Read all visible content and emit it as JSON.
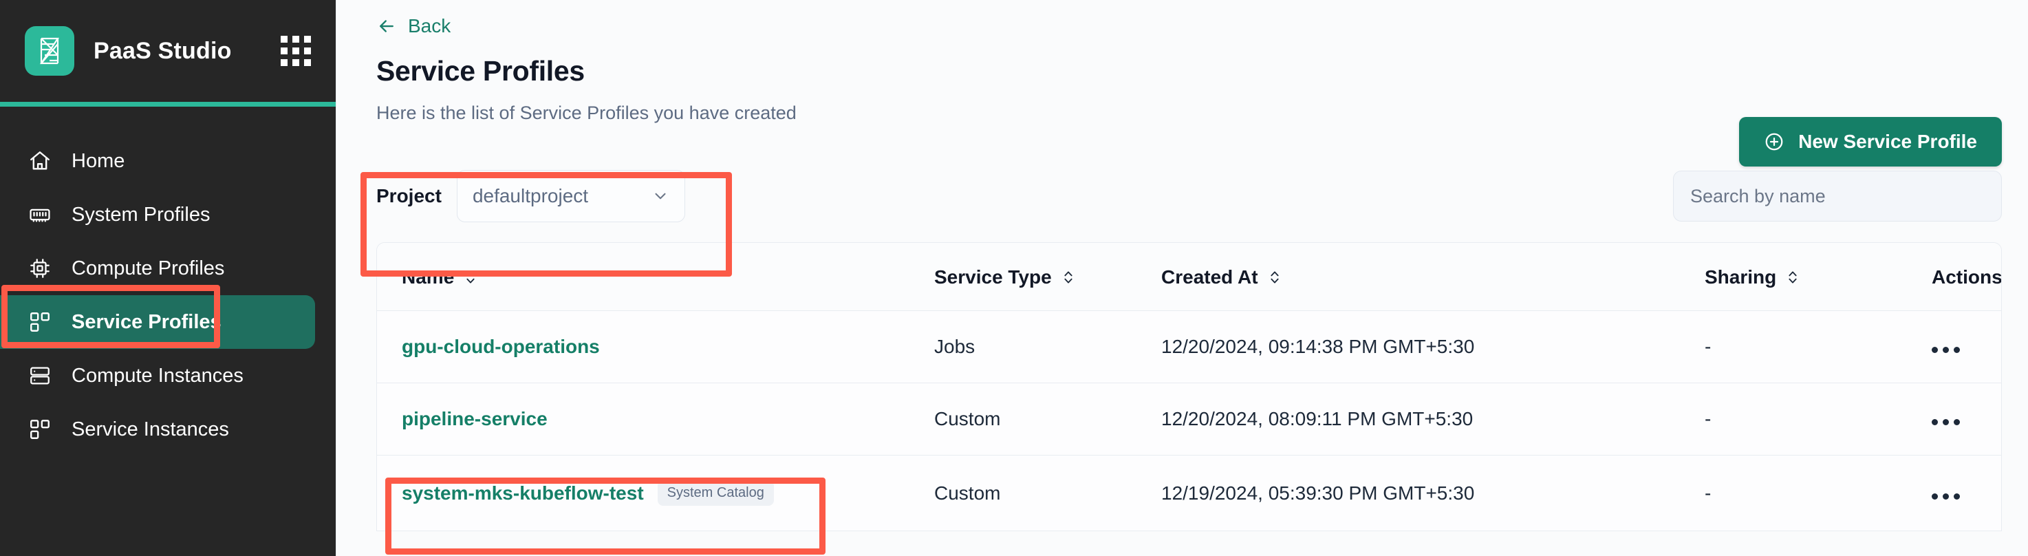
{
  "sidebar": {
    "brand": "PaaS Studio",
    "logo_icon": "paas-logo-icon",
    "apps_grid_icon": "apps-grid-icon",
    "accent_color": "#2cb99a",
    "background_color": "#262626",
    "active_item_color": "#1f6f5f",
    "items": [
      {
        "label": "Home",
        "icon": "home-icon",
        "active": false
      },
      {
        "label": "System Profiles",
        "icon": "memory-chip-icon",
        "active": false
      },
      {
        "label": "Compute Profiles",
        "icon": "cpu-icon",
        "active": false
      },
      {
        "label": "Service Profiles",
        "icon": "blocks-icon",
        "active": true
      },
      {
        "label": "Compute Instances",
        "icon": "server-icon",
        "active": false
      },
      {
        "label": "Service Instances",
        "icon": "blocks-icon",
        "active": false
      }
    ]
  },
  "header": {
    "back_label": "Back",
    "back_icon": "arrow-left-icon",
    "title": "Service Profiles",
    "subtitle": "Here is the list of Service Profiles you have created",
    "new_button_label": "New Service Profile",
    "new_button_icon": "plus-circle-icon",
    "new_button_color": "#157f67"
  },
  "filters": {
    "project_label": "Project",
    "project_value": "defaultproject",
    "project_chevron_icon": "chevron-down-icon",
    "search_placeholder": "Search by name",
    "search_value": ""
  },
  "table": {
    "columns": [
      {
        "label": "Name",
        "sortable": true,
        "sort_icon": "sort-updown-icon"
      },
      {
        "label": "Service Type",
        "sortable": true,
        "sort_icon": "sort-updown-icon"
      },
      {
        "label": "Created At",
        "sortable": true,
        "sort_icon": "sort-updown-icon"
      },
      {
        "label": "Sharing",
        "sortable": true,
        "sort_icon": "sort-updown-icon"
      },
      {
        "label": "Actions",
        "sortable": false,
        "sort_icon": ""
      }
    ],
    "rows": [
      {
        "name": "gpu-cloud-operations",
        "badge": "",
        "service_type": "Jobs",
        "created_at": "12/20/2024, 09:14:38 PM GMT+5:30",
        "sharing": "-",
        "actions_icon": "kebab-menu-icon"
      },
      {
        "name": "pipeline-service",
        "badge": "",
        "service_type": "Custom",
        "created_at": "12/20/2024, 08:09:11 PM GMT+5:30",
        "sharing": "-",
        "actions_icon": "kebab-menu-icon"
      },
      {
        "name": "system-mks-kubeflow-test",
        "badge": "System Catalog",
        "service_type": "Custom",
        "created_at": "12/19/2024, 05:39:30 PM GMT+5:30",
        "sharing": "-",
        "actions_icon": "kebab-menu-icon"
      }
    ]
  },
  "annotations": {
    "color": "#fc5a47",
    "boxes": [
      {
        "name": "sidebar-service-profiles-highlight"
      },
      {
        "name": "project-selector-highlight"
      },
      {
        "name": "system-catalog-row-highlight"
      }
    ]
  }
}
